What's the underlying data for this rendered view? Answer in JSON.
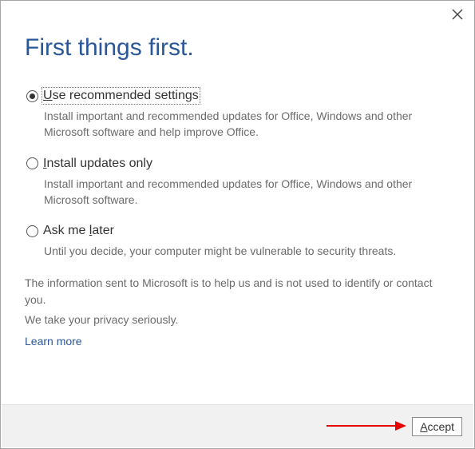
{
  "title": "First things first.",
  "options": [
    {
      "label_pre": "",
      "label_u": "U",
      "label_post": "se recommended settings",
      "desc": "Install important and recommended updates for Office, Windows and other Microsoft software and help improve Office.",
      "checked": true
    },
    {
      "label_pre": "",
      "label_u": "I",
      "label_post": "nstall updates only",
      "desc": "Install important and recommended updates for Office, Windows and other Microsoft software.",
      "checked": false
    },
    {
      "label_pre": "Ask me ",
      "label_u": "l",
      "label_post": "ater",
      "desc": "Until you decide, your computer might be vulnerable to security threats.",
      "checked": false
    }
  ],
  "info_line1": "The information sent to Microsoft is to help us and is not used to identify or contact you.",
  "info_line2": "We take your privacy seriously.",
  "learn_more": "Learn more",
  "accept_pre": "",
  "accept_u": "A",
  "accept_post": "ccept"
}
